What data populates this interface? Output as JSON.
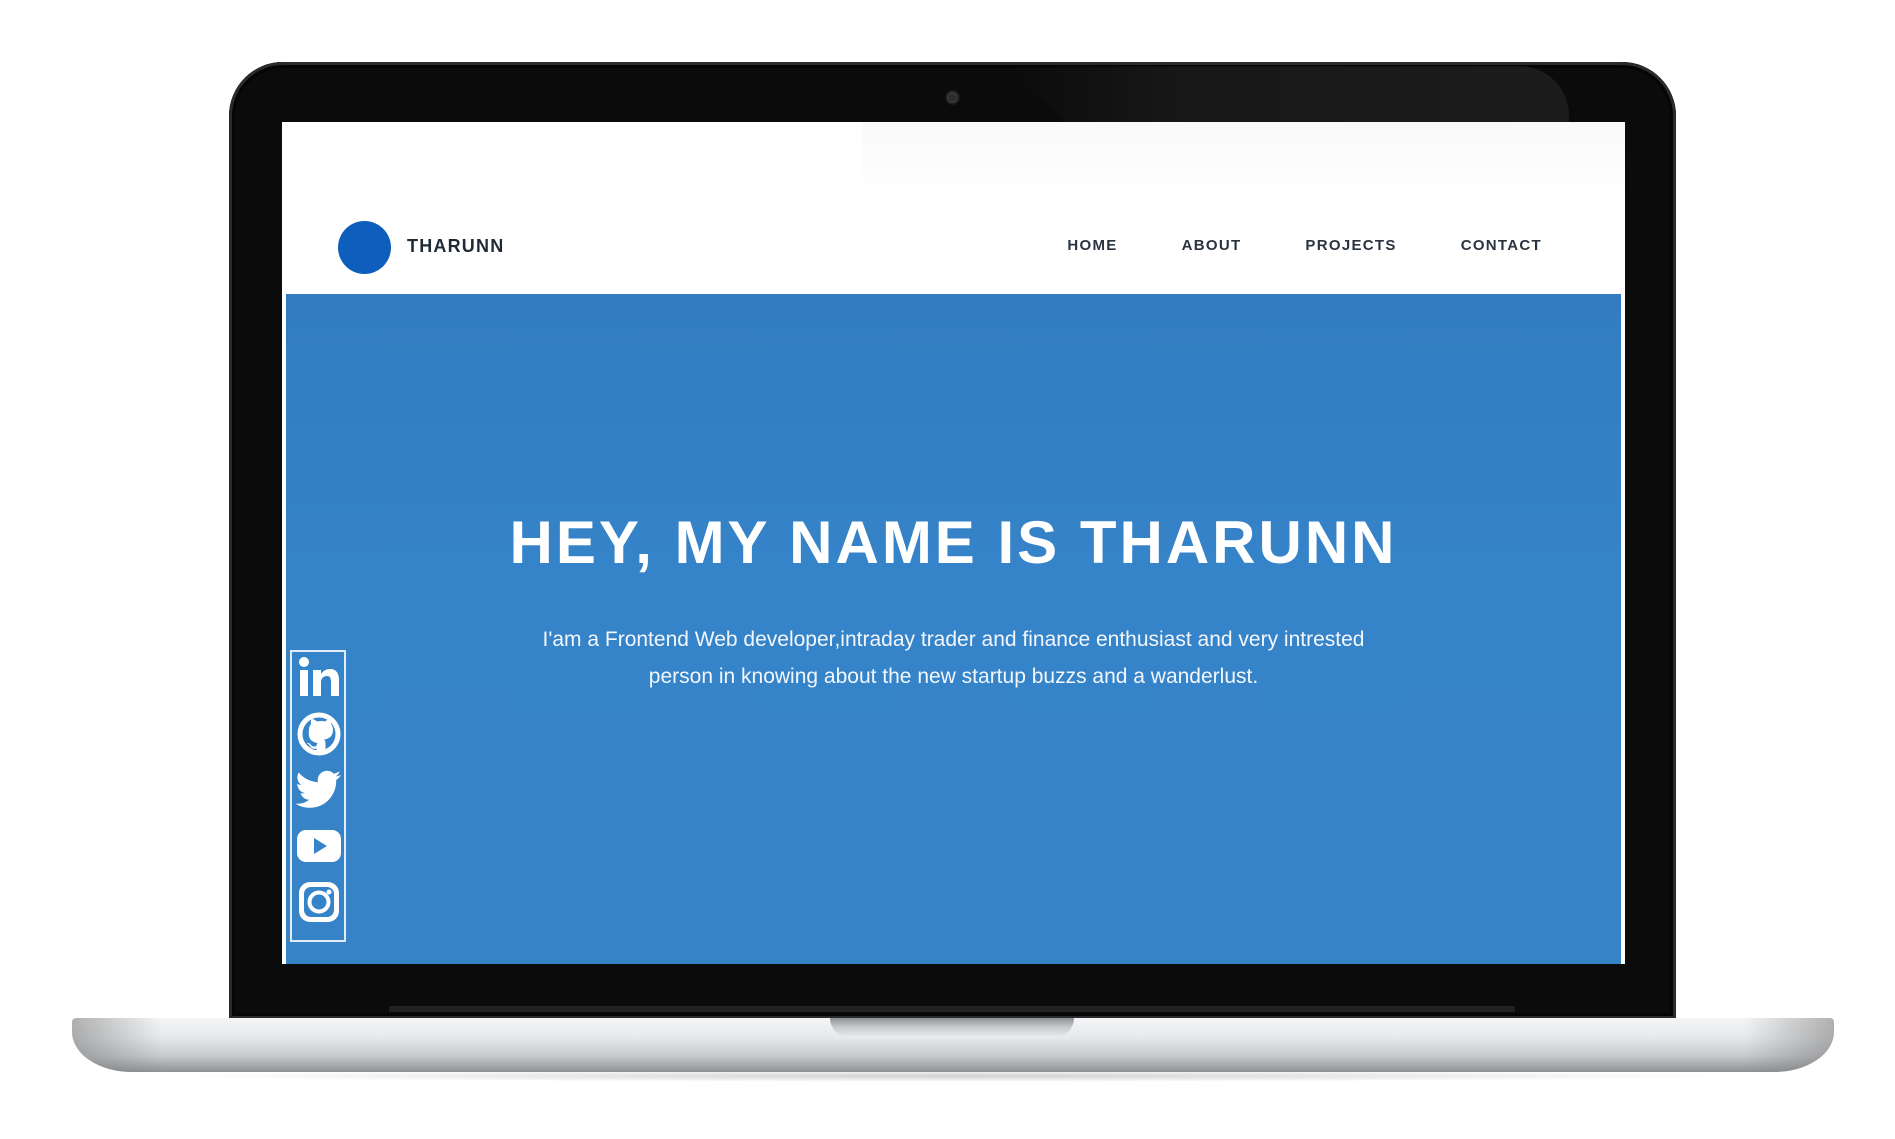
{
  "site": {
    "brand": "THARUNN",
    "brand_color": "#0e5fbd",
    "hero_color": "#3583c8"
  },
  "nav": {
    "items": [
      {
        "label": "HOME"
      },
      {
        "label": "ABOUT"
      },
      {
        "label": "PROJECTS"
      },
      {
        "label": "CONTACT"
      }
    ]
  },
  "hero": {
    "title": "HEY, MY NAME IS THARUNN",
    "subtitle": "I'am a Frontend Web developer,intraday trader and finance enthusiast and very intrested person in knowing about the new startup buzzs and a wanderlust."
  },
  "social": {
    "icons": [
      "linkedin-icon",
      "github-icon",
      "twitter-icon",
      "youtube-icon",
      "instagram-icon"
    ]
  }
}
